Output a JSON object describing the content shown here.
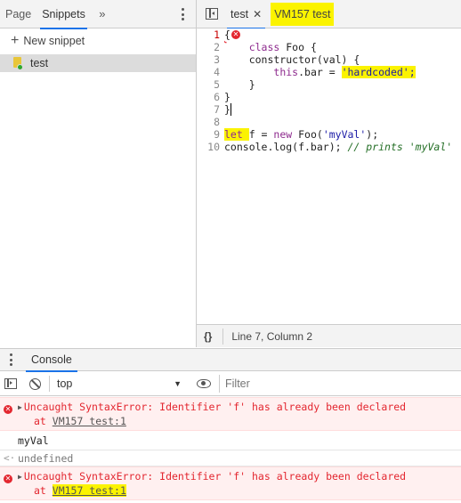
{
  "navigator": {
    "tabs": [
      "Page",
      "Snippets"
    ],
    "active_tab": "Snippets",
    "more_icon": "double-chevron-icon",
    "new_snippet_label": "New snippet",
    "snippets": [
      {
        "name": "test"
      }
    ]
  },
  "editor": {
    "tabs": [
      {
        "label": "test",
        "closeable": true,
        "active": true
      },
      {
        "label": "VM157 test",
        "closeable": false,
        "active": false
      }
    ],
    "status": "Line 7, Column 2",
    "format_label": "{}",
    "lines": [
      {
        "n": "1",
        "text": "{"
      },
      {
        "n": "2",
        "text": "    class Foo {"
      },
      {
        "n": "3",
        "text": "    constructor(val) {"
      },
      {
        "n": "4",
        "text": "        this.bar = 'hardcoded';"
      },
      {
        "n": "5",
        "text": "    }"
      },
      {
        "n": "6",
        "text": "}"
      },
      {
        "n": "7",
        "text": "}"
      },
      {
        "n": "8",
        "text": ""
      },
      {
        "n": "9",
        "text": "let f = new Foo('myVal');"
      },
      {
        "n": "10",
        "text": "console.log(f.bar); // prints 'myVal'"
      }
    ]
  },
  "drawer": {
    "tab": "Console"
  },
  "console_toolbar": {
    "context": "top",
    "filter_placeholder": "Filter"
  },
  "console": {
    "messages": [
      {
        "type": "error",
        "text": "Uncaught SyntaxError: Identifier 'f' has already been declared",
        "source": "VM157 test:1",
        "at": "at "
      },
      {
        "type": "log",
        "text": "myVal"
      },
      {
        "type": "result",
        "text": "undefined"
      },
      {
        "type": "error",
        "text": "Uncaught SyntaxError: Identifier 'f' has already been declared",
        "source": "VM157 test:1",
        "at": "at "
      }
    ],
    "prompt": "›"
  },
  "colors": {
    "highlight": "#fbf300",
    "error": "#e3262f",
    "accent": "#1a73e8"
  }
}
